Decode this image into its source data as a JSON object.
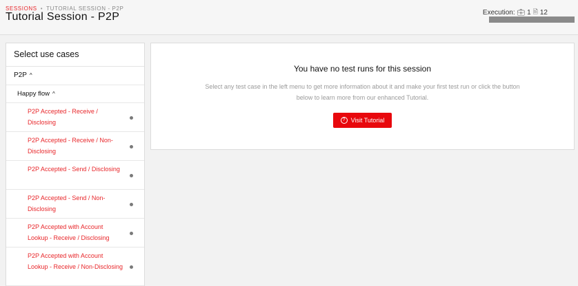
{
  "breadcrumb": {
    "root": "SESSIONS",
    "separator": "•",
    "current": "TUTORIAL SESSION - P2P"
  },
  "page": {
    "title": "Tutorial Session - P2P"
  },
  "execution": {
    "label": "Execution:",
    "count_a": "1",
    "count_b": "12"
  },
  "sidebar": {
    "heading": "Select use cases",
    "group": {
      "label": "P2P",
      "caret": "^"
    },
    "subgroup": {
      "label": "Happy flow",
      "caret": "^"
    },
    "cases": [
      {
        "label": "P2P Accepted - Receive / Disclosing"
      },
      {
        "label": "P2P Accepted - Receive / Non-Disclosing"
      },
      {
        "label": "P2P Accepted - Send / Disclosing"
      },
      {
        "label": "P2P Accepted - Send / Non-Disclosing"
      },
      {
        "label": "P2P Accepted with Account Lookup - Receive / Disclosing"
      },
      {
        "label": "P2P Accepted with Account Lookup - Receive / Non-Disclosing"
      }
    ]
  },
  "empty_state": {
    "heading": "You have no test runs for this session",
    "message": "Select any test case in the left menu to get more information about it and make your first test run or click the button below to learn more from our enhanced Tutorial.",
    "button_label": "Visit Tutorial",
    "button_icon": "?"
  },
  "colors": {
    "accent": "#e8262a",
    "button": "#e8080d"
  }
}
